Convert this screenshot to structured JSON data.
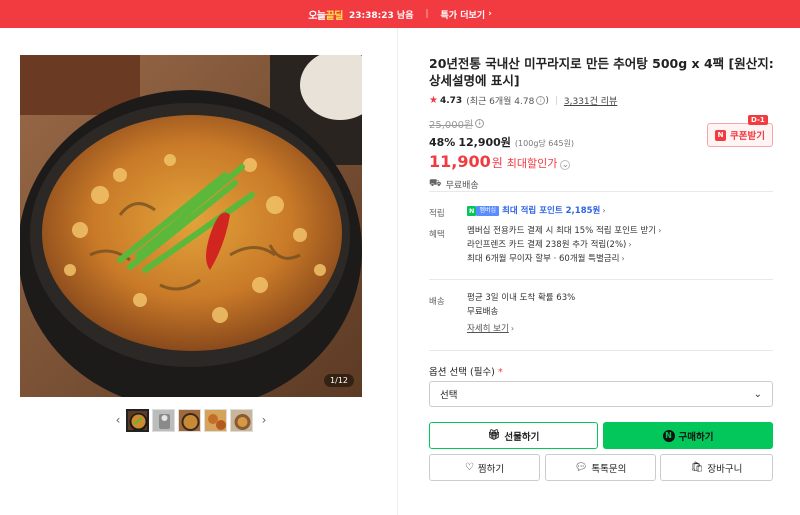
{
  "banner": {
    "brand_prefix": "오늘",
    "brand_highlight": "끝딜",
    "time_left": "23:38:23 남음",
    "more_label": "특가 더보기",
    "color": "#f23a41"
  },
  "gallery": {
    "counter": "1/12",
    "prev_icon": "chevron-left-icon",
    "next_icon": "chevron-right-icon",
    "thumbnail_count": 5,
    "active_index": 0
  },
  "product": {
    "title": "20년전통 국내산 미꾸라지로 만든 추어탕 500g x 4팩 [원산지: 상세설명에 표시]",
    "rating": "4.73",
    "rating_recent": "(최근 6개월 4.78",
    "rating_recent_close": ")",
    "review_count": "3,331건 리뷰",
    "original_price": "25,000원",
    "discount_pct": "48%",
    "sale_price": "12,900원",
    "unit_price": "(100g당 645원)",
    "max_discount_price": "11,900",
    "max_discount_won": "원",
    "max_discount_label": "최대할인가",
    "free_shipping": "무료배송",
    "coupon_label": "쿠폰받기",
    "coupon_dday": "D-1"
  },
  "points": {
    "label": "적립",
    "max_points": "최대 적립 포인트 2,185원",
    "npay_badge": "N",
    "plus_badge": "멤버십"
  },
  "benefits": {
    "label": "혜택",
    "items": [
      "멤버십 전용카드 결제 시 최대 15% 적립 포인트 받기",
      "라인프렌즈 카드 결제 238원 추가 적립(2%)",
      "최대 6개월 무이자 할부 · 60개월 특별금리"
    ]
  },
  "delivery": {
    "label": "배송",
    "lines": [
      "평균 3일 이내 도착 확률 63%",
      "무료배송"
    ],
    "detail_link": "자세히 보기"
  },
  "option": {
    "label": "옵션 선택 (필수)",
    "required_mark": "*",
    "select_value": "선택"
  },
  "buttons": {
    "gift": "선물하기",
    "buy": "구매하기",
    "zzim": "찜하기",
    "talk": "톡톡문의",
    "cart": "장바구니"
  },
  "colors": {
    "accent_red": "#f23a41",
    "naver_green": "#03c75a"
  }
}
